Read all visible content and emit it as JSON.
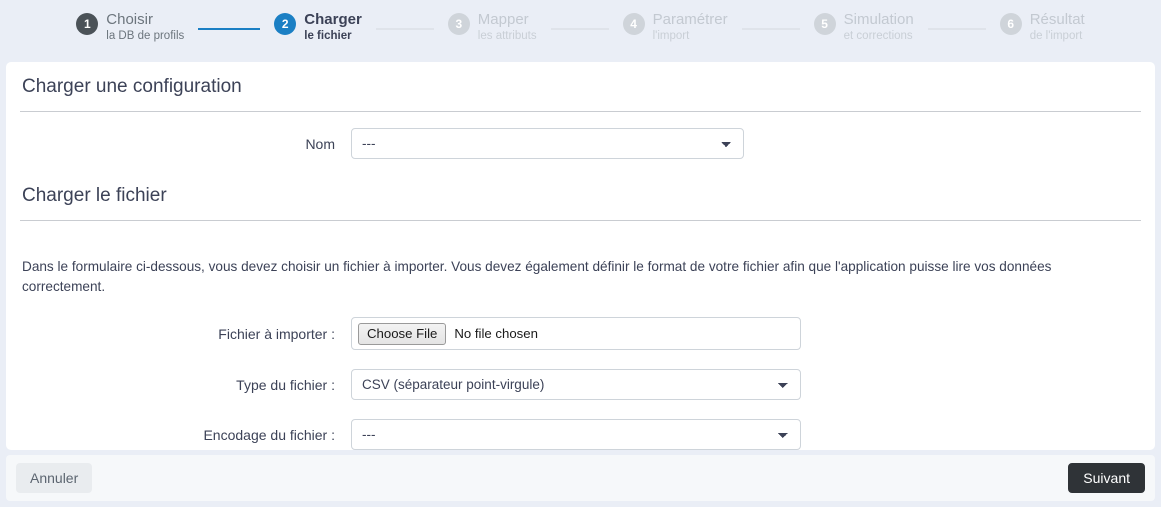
{
  "stepper": {
    "steps": [
      {
        "number": "1",
        "title": "Choisir",
        "subtitle": "la DB de profils",
        "state": "done"
      },
      {
        "number": "2",
        "title": "Charger",
        "subtitle": "le fichier",
        "state": "active"
      },
      {
        "number": "3",
        "title": "Mapper",
        "subtitle": "les attributs",
        "state": "todo"
      },
      {
        "number": "4",
        "title": "Paramétrer",
        "subtitle": "l'import",
        "state": "todo"
      },
      {
        "number": "5",
        "title": "Simulation",
        "subtitle": "et corrections",
        "state": "todo"
      },
      {
        "number": "6",
        "title": "Résultat",
        "subtitle": "de l'import",
        "state": "todo"
      }
    ],
    "colors": {
      "done_badge": "#4b5258",
      "active_badge": "#1b7fc4",
      "todo_badge": "#cfd4da",
      "connector_done": "#1b7fc4",
      "connector_todo": "#dfe3ea"
    }
  },
  "config_section": {
    "title": "Charger une configuration",
    "name_label": "Nom",
    "name_value": "---",
    "name_options": [
      "---"
    ]
  },
  "file_section": {
    "title": "Charger le fichier",
    "intro": "Dans le formulaire ci-dessous, vous devez choisir un fichier à importer. Vous devez également définir le format de votre fichier afin que l'application puisse lire vos données correctement.",
    "file_label": "Fichier à importer :",
    "file_button": "Choose File",
    "file_status": "No file chosen",
    "type_label": "Type du fichier :",
    "type_value": "CSV (séparateur point-virgule)",
    "type_options": [
      "CSV (séparateur point-virgule)"
    ],
    "encoding_label": "Encodage du fichier :",
    "encoding_value": "---",
    "encoding_options": [
      "---"
    ]
  },
  "footer": {
    "cancel_label": "Annuler",
    "next_label": "Suivant",
    "next_color": "#2f3337"
  }
}
